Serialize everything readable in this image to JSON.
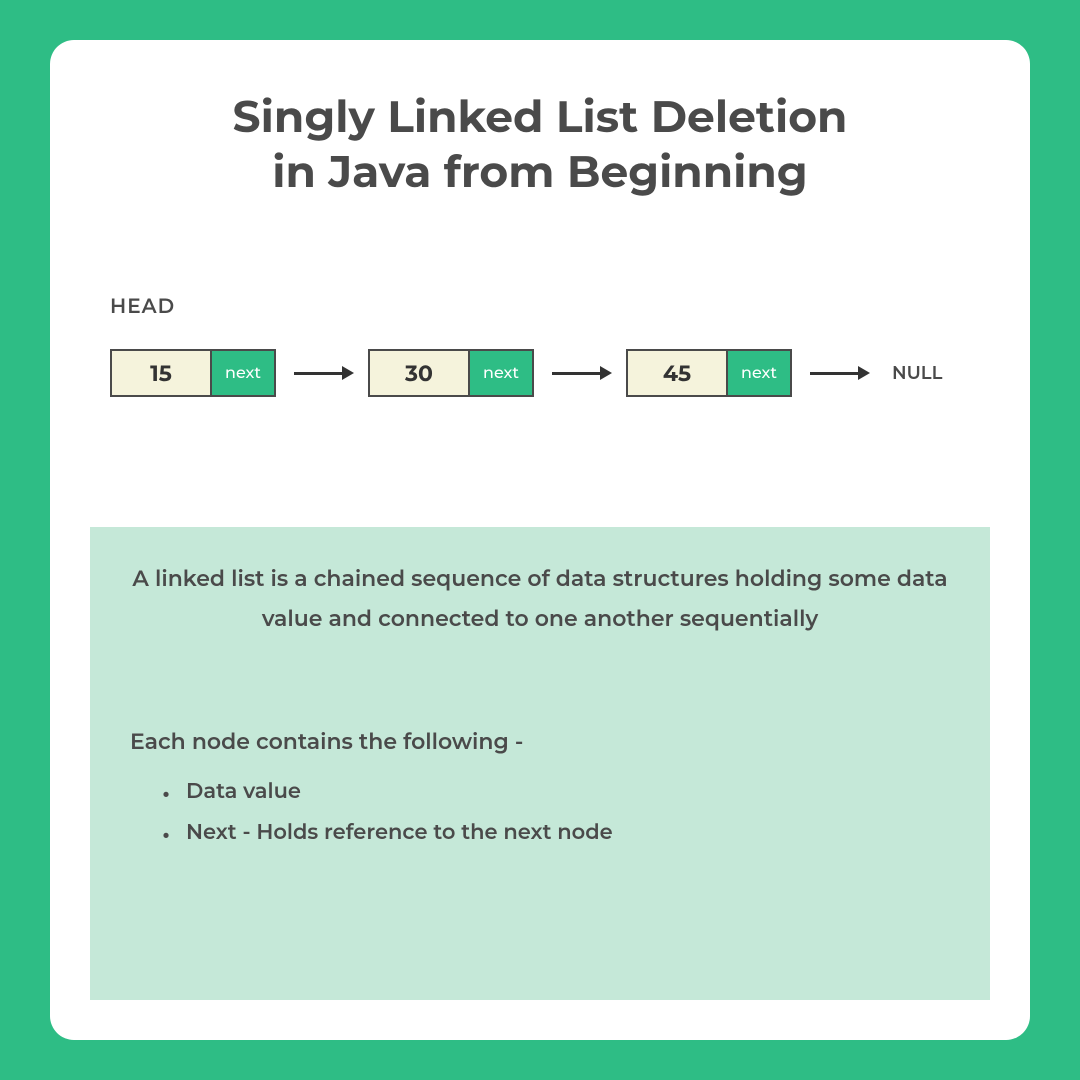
{
  "title_line1": "Singly Linked List Deletion",
  "title_line2": "in Java from Beginning",
  "head_label": "HEAD",
  "null_label": "NULL",
  "next_label": "next",
  "nodes": [
    {
      "value": "15"
    },
    {
      "value": "30"
    },
    {
      "value": "45"
    }
  ],
  "description": "A linked list is a chained sequence of data structures holding some data value and connected to one another sequentially",
  "subtitle": "Each node contains the following -",
  "bullets": [
    "Data value",
    "Next - Holds reference to the next node"
  ]
}
